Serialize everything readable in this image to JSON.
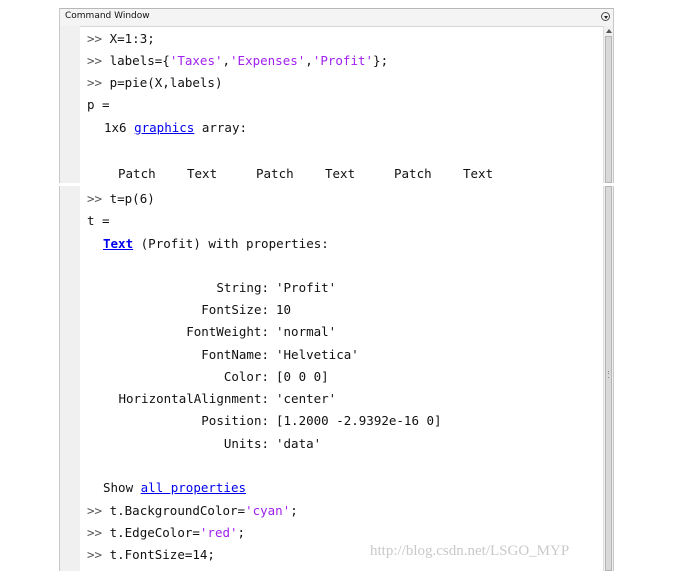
{
  "window": {
    "title": "Command Window"
  },
  "session": {
    "prompt": ">>",
    "cmd1": {
      "text": "X=1:3;"
    },
    "cmd2": {
      "prefix": "labels={",
      "s1": "'Taxes'",
      "sep1": ",",
      "s2": "'Expenses'",
      "sep2": ",",
      "s3": "'Profit'",
      "suffix": "};"
    },
    "cmd3": {
      "text": "p=pie(X,labels)"
    },
    "p_header": "p =",
    "p_size": "1x6",
    "p_link": "graphics",
    "p_array": "array:",
    "columns": [
      "Patch",
      "Text",
      "Patch",
      "Text",
      "Patch",
      "Text"
    ],
    "cmd4": {
      "text": "t=p(6)"
    },
    "t_header": "t =",
    "t_link": "Text",
    "t_desc": "(Profit) with properties:",
    "properties": [
      {
        "name": "String:",
        "value": "'Profit'"
      },
      {
        "name": "FontSize:",
        "value": "10"
      },
      {
        "name": "FontWeight:",
        "value": "'normal'"
      },
      {
        "name": "FontName:",
        "value": "'Helvetica'"
      },
      {
        "name": "Color:",
        "value": "[0 0 0]"
      },
      {
        "name": "HorizontalAlignment:",
        "value": "'center'"
      },
      {
        "name": "Position:",
        "value": "[1.2000 -2.9392e-16 0]"
      },
      {
        "name": "Units:",
        "value": "'data'"
      }
    ],
    "show_word": "Show",
    "show_link": "all properties",
    "cmd5": {
      "prefix": "t.BackgroundColor=",
      "s": "'cyan'",
      "suffix": ";"
    },
    "cmd6": {
      "prefix": "t.EdgeColor=",
      "s": "'red'",
      "suffix": ";"
    },
    "cmd7": {
      "text": "t.FontSize=14;"
    }
  },
  "watermark": "http://blog.csdn.net/LSGO_MYP",
  "colors": {
    "string": "#a020f0",
    "link": "#0000ee",
    "text": "#111111",
    "background": "#ffffff"
  },
  "icons": {
    "title_menu": "options-menu-icon",
    "scroll_up": "arrow-up-icon",
    "scroll_grip": "grip-icon"
  }
}
